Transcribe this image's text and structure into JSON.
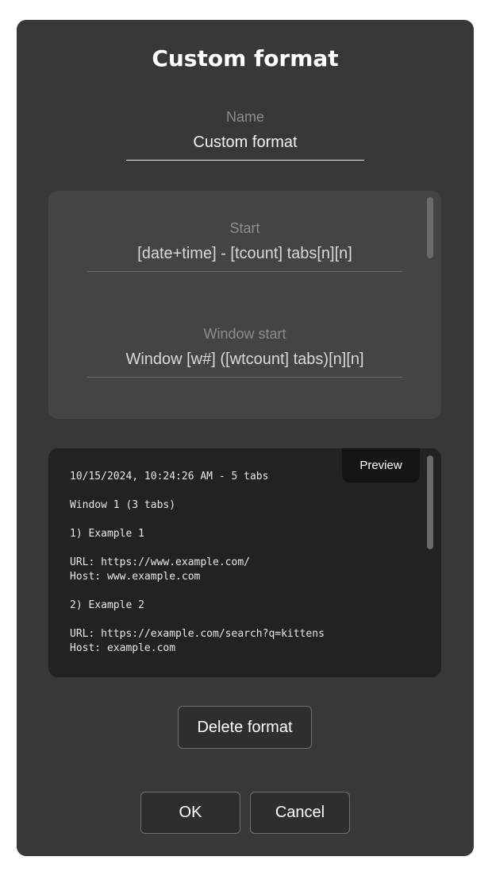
{
  "dialog": {
    "title": "Custom format"
  },
  "name_field": {
    "label": "Name",
    "value": "Custom format"
  },
  "templates": {
    "start": {
      "label": "Start",
      "value": "[date+time] - [tcount] tabs[n][n]"
    },
    "window_start": {
      "label": "Window start",
      "value": "Window [w#] ([wtcount] tabs)[n][n]"
    }
  },
  "preview": {
    "tab_label": "Preview",
    "lines": [
      "10/15/2024, 10:24:26 AM - 5 tabs",
      "",
      "Window 1 (3 tabs)",
      "",
      "1) Example 1",
      "",
      "URL: https://www.example.com/",
      "Host: www.example.com",
      "",
      "2) Example 2",
      "",
      "URL: https://example.com/search?q=kittens",
      "Host: example.com"
    ]
  },
  "buttons": {
    "delete": "Delete format",
    "ok": "OK",
    "cancel": "Cancel"
  },
  "colors": {
    "dialog_bg": "#383838",
    "panel_bg": "#444444",
    "preview_bg": "#222222",
    "text": "#ffffff",
    "label": "#8c8c8c"
  }
}
